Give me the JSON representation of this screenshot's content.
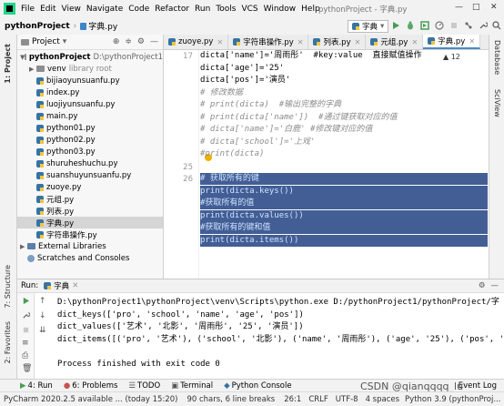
{
  "menubar": {
    "items": [
      "File",
      "Edit",
      "View",
      "Navigate",
      "Code",
      "Refactor",
      "Run",
      "Tools",
      "VCS",
      "Window",
      "Help"
    ],
    "window_title": "pythonProject - 字典.py",
    "min": "—",
    "max": "□",
    "close": "✕"
  },
  "navbar": {
    "project": "pythonProject",
    "file": "字典.py",
    "run_config": "字典"
  },
  "sidebar": {
    "project_tab": "1: Project",
    "structure_tab": "7: Structure",
    "favorites_tab": "2: Favorites"
  },
  "right_strip": {
    "database": "Database",
    "sciview": "SciView"
  },
  "project_panel": {
    "title": "Project",
    "root": {
      "name": "pythonProject",
      "path": "D:\\pythonProject1"
    },
    "venv": {
      "name": "venv",
      "tag": "library root"
    },
    "files": [
      "bijiaoyunsuanfu.py",
      "index.py",
      "luojiyunsuanfu.py",
      "main.py",
      "python01.py",
      "python02.py",
      "python03.py",
      "shuruheshuchu.py",
      "suanshuyunsuanfu.py",
      "zuoye.py",
      "元组.py",
      "列表.py",
      "字典.py",
      "字符串操作.py"
    ],
    "selected": "字典.py",
    "external": "External Libraries",
    "scratches": "Scratches and Consoles"
  },
  "tabs": [
    {
      "label": "zuoye.py",
      "active": false
    },
    {
      "label": "字符串操作.py",
      "active": false
    },
    {
      "label": "列表.py",
      "active": false
    },
    {
      "label": "元组.py",
      "active": false
    },
    {
      "label": "字典.py",
      "active": true
    }
  ],
  "editor": {
    "warnings": "▲ 12",
    "lines": [
      {
        "n": "17",
        "text": "dicta['name']='周雨彤'  #key:value  直接赋值操作",
        "kind": "code"
      },
      {
        "n": "",
        "text": "dicta['age']='25'",
        "kind": "code"
      },
      {
        "n": "",
        "text": "dicta['pos']='演员'",
        "kind": "code"
      },
      {
        "n": "",
        "text": "# 修改数据",
        "kind": "comment"
      },
      {
        "n": "",
        "text": "# print(dicta)  #输出完整的字典",
        "kind": "comment"
      },
      {
        "n": "",
        "text": "# print(dicta['name'])  #通过键获取对应的值",
        "kind": "comment"
      },
      {
        "n": "",
        "text": "# dicta['name']='白鹿' #修改键对应的值",
        "kind": "comment"
      },
      {
        "n": "",
        "text": "# dicta['school']='上戏'",
        "kind": "comment"
      },
      {
        "n": "",
        "text": "#print(dicta)",
        "kind": "comment"
      },
      {
        "n": "25",
        "text": "",
        "kind": "code"
      },
      {
        "n": "26",
        "text": "# 获取所有的键",
        "kind": "sel"
      },
      {
        "n": "",
        "text": "print(dicta.keys())",
        "kind": "sel"
      },
      {
        "n": "",
        "text": "#获取所有的值",
        "kind": "sel"
      },
      {
        "n": "",
        "text": "print(dicta.values())",
        "kind": "sel"
      },
      {
        "n": "",
        "text": "#获取所有的键和值",
        "kind": "sel"
      },
      {
        "n": "",
        "text": "print(dicta.items())",
        "kind": "sel"
      }
    ]
  },
  "run_panel": {
    "label": "Run:",
    "config": "字典",
    "output": [
      "D:\\pythonProject1\\pythonProject\\venv\\Scripts\\python.exe D:/pythonProject1/pythonProject/字",
      "dict_keys(['pro', 'school', 'name', 'age', 'pos'])",
      "dict_values(['艺术', '北影', '周雨彤', '25', '演员'])",
      "dict_items([('pro', '艺术'), ('school', '北影'), ('name', '周雨彤'), ('age', '25'), ('pos', '",
      "",
      "Process finished with exit code 0"
    ]
  },
  "bottom_tabs": [
    "4: Run",
    "6: Problems",
    "TODO",
    "Terminal",
    "Python Console",
    "Event Log"
  ],
  "statusbar": {
    "message": "PyCharm 2020.2.5 available ... (today 15:20)",
    "selection": "90 chars, 6 line breaks",
    "position": "26:1",
    "line_sep": "CRLF",
    "encoding": "UTF-8",
    "indent": "4 spaces",
    "interpreter": "Python 3.9 (pythonProj..."
  },
  "watermark": "CSDN @qianqqqq_lu",
  "colors": {
    "selection": "#214283",
    "accent": "#4a88c7",
    "comment": "#8c8c8c",
    "string": "#067d17"
  }
}
